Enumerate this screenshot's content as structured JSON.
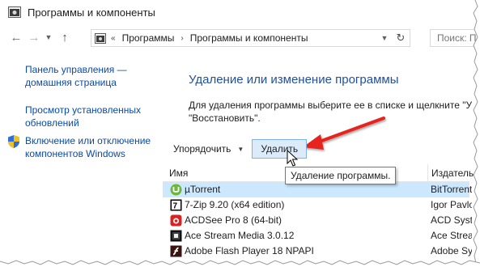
{
  "window": {
    "title": "Программы и компоненты"
  },
  "nav": {
    "back_icon": "arrow-left-icon",
    "forward_icon": "arrow-right-icon",
    "recent_icon": "chevron-down-icon",
    "up_icon": "arrow-up-icon"
  },
  "address": {
    "prefix": "«",
    "crumbs": [
      "Программы",
      "Программы и компоненты"
    ],
    "separator": "›"
  },
  "search": {
    "placeholder": "Поиск: П"
  },
  "sidebar": {
    "items": [
      {
        "label": "Панель управления — домашняя страница"
      },
      {
        "label": "Просмотр установленных обновлений"
      },
      {
        "label": "Включение или отключение компонентов Windows",
        "icon": "shield-icon"
      }
    ]
  },
  "main": {
    "title": "Удаление или изменение программы",
    "description": "Для удаления программы выберите ее в списке и щелкните \"У\n\"Восстановить\"."
  },
  "toolbar": {
    "organize_label": "Упорядочить",
    "uninstall_label": "Удалить"
  },
  "tooltip": {
    "text": "Удаление программы."
  },
  "table": {
    "columns": [
      "Имя",
      "Издатель"
    ],
    "rows": [
      {
        "name": "µTorrent",
        "publisher": "BitTorrent",
        "icon": "utorrent-icon",
        "selected": true
      },
      {
        "name": "7-Zip 9.20 (x64 edition)",
        "publisher": "Igor Pavlov",
        "icon": "7zip-icon",
        "selected": false
      },
      {
        "name": "ACDSee Pro 8 (64-bit)",
        "publisher": "ACD Syste",
        "icon": "acdsee-icon",
        "selected": false
      },
      {
        "name": "Ace Stream Media 3.0.12",
        "publisher": "Ace Stream",
        "icon": "acestream-icon",
        "selected": false
      },
      {
        "name": "Adobe Flash Player 18 NPAPI",
        "publisher": "Adobe Syste",
        "icon": "flash-icon",
        "selected": false
      }
    ]
  },
  "colors": {
    "link": "#0b4aa7",
    "heading": "#1f4f9e",
    "selection": "#cce8ff",
    "button_hover": "#dcebfa",
    "arrow": "#e8201b"
  }
}
